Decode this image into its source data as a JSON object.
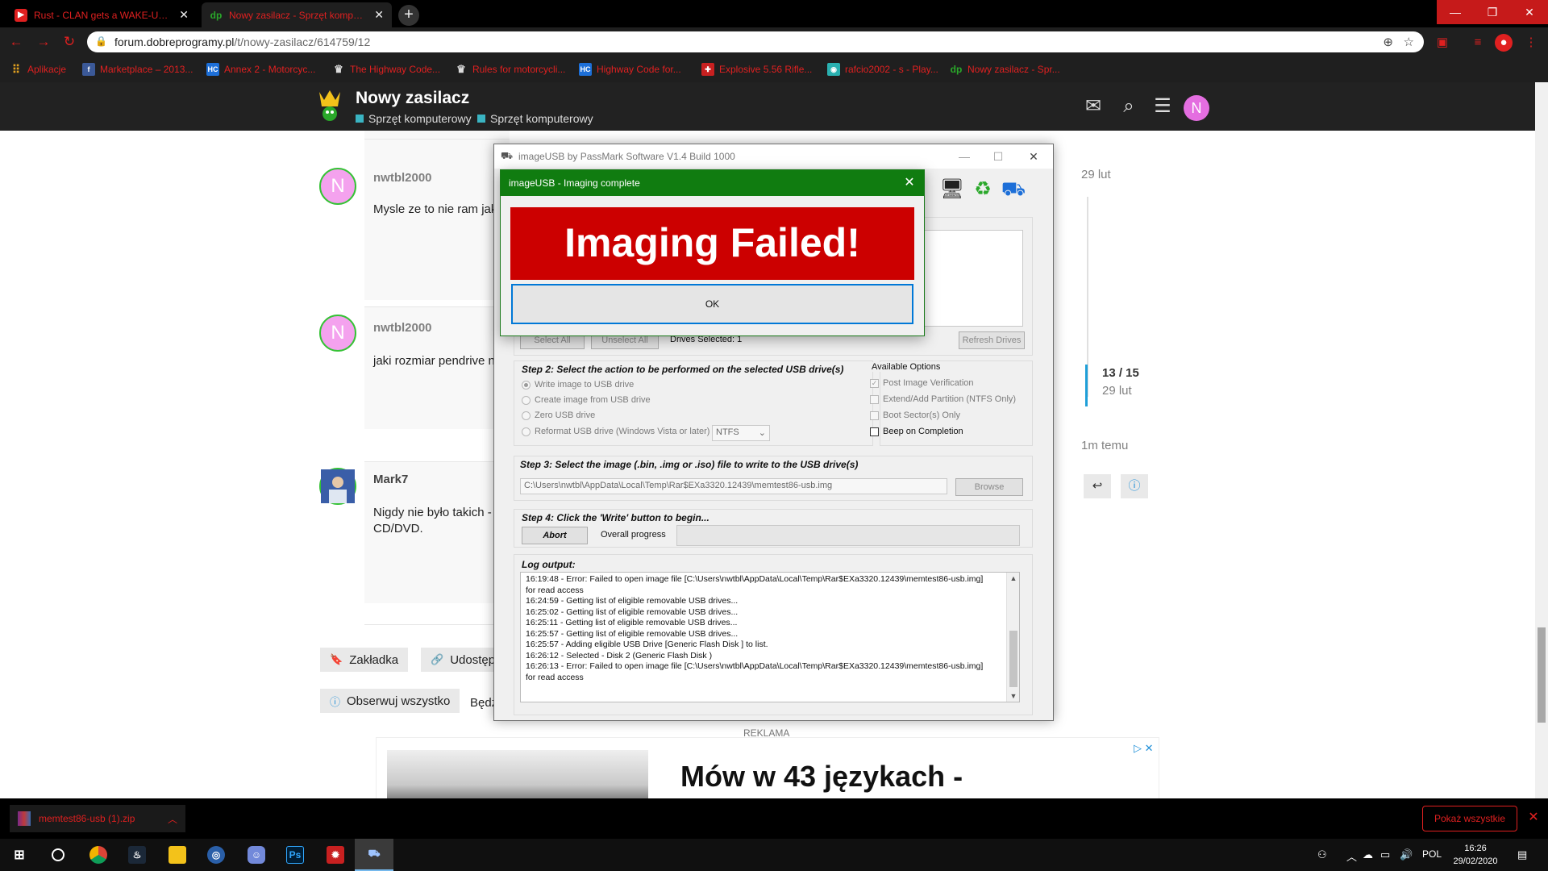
{
  "browser": {
    "tabs": [
      {
        "title": "Rust - CLAN gets a WAKE-UP CA",
        "favicon": "youtube-icon"
      },
      {
        "title": "Nowy zasilacz - Sprzęt komputer",
        "favicon": "dp-icon"
      }
    ],
    "new_tab": "+",
    "url_host": "forum.dobreprogramy.pl",
    "url_path": "/t/nowy-zasilacz/614759/12",
    "bookmarks": [
      {
        "label": "Aplikacje",
        "icon": "apps-grid-icon"
      },
      {
        "label": "Marketplace – 2013...",
        "icon": "facebook-icon"
      },
      {
        "label": "Annex 2 - Motorcyc...",
        "icon": "hc-icon"
      },
      {
        "label": "The Highway Code...",
        "icon": "crown-icon"
      },
      {
        "label": "Rules for motorcycli...",
        "icon": "crown-icon"
      },
      {
        "label": "Highway Code for...",
        "icon": "hc-icon"
      },
      {
        "label": "Explosive 5.56 Rifle...",
        "icon": "target-icon"
      },
      {
        "label": "rafcio2002 - s - Play...",
        "icon": "game-icon"
      },
      {
        "label": "Nowy zasilacz - Spr...",
        "icon": "dp-icon"
      }
    ]
  },
  "site": {
    "topic_title": "Nowy zasilacz",
    "categories": [
      "Sprzęt komputerowy",
      "Sprzęt komputerowy"
    ],
    "user_initial": "N"
  },
  "posts": [
    {
      "initial": "N",
      "username": "nwtbl2000",
      "text": "Mysle ze to nie ram jak"
    },
    {
      "initial": "N",
      "username": "nwtbl2000",
      "text": "jaki rozmiar pendrive n"
    },
    {
      "initial": "",
      "username": "Mark7",
      "text_line1": "Nigdy nie było takich -",
      "text_line2": "CD/DVD."
    }
  ],
  "actions": {
    "bookmark": "Zakładka",
    "share": "Udostęp",
    "watch": "Obserwuj wszystko",
    "partial": "Będz"
  },
  "timeline": {
    "top_date": "29 lut",
    "position": "13 / 15",
    "position_date": "29 lut",
    "bottom": "1m temu"
  },
  "ad": {
    "label": "REKLAMA",
    "headline": "Mów w 43 językach -"
  },
  "imageusb": {
    "window_title": "imageUSB by PassMark Software V1.4 Build 1000",
    "select_all": "Select All",
    "unselect_all": "Unselect All",
    "drives_selected": "Drives Selected: 1",
    "refresh_drives": "Refresh Drives",
    "step2_label": "Step 2: Select the action to be performed on the selected USB drive(s)",
    "actions": [
      {
        "label": "Write image to USB drive",
        "selected": true
      },
      {
        "label": "Create image from USB drive",
        "selected": false
      },
      {
        "label": "Zero USB drive",
        "selected": false
      },
      {
        "label": "Reformat USB drive (Windows Vista or later)",
        "selected": false
      }
    ],
    "fs_value": "NTFS",
    "options_label": "Available Options",
    "options": [
      {
        "label": "Post Image Verification",
        "checked": true,
        "enabled": false
      },
      {
        "label": "Extend/Add Partition (NTFS Only)",
        "checked": false,
        "enabled": false
      },
      {
        "label": "Boot Sector(s) Only",
        "checked": false,
        "enabled": false
      },
      {
        "label": "Beep on Completion",
        "checked": false,
        "enabled": true
      }
    ],
    "step3_label": "Step 3: Select the image (.bin, .img or .iso) file to write to the USB drive(s)",
    "image_path": "C:\\Users\\nwtbl\\AppData\\Local\\Temp\\Rar$EXa3320.12439\\memtest86-usb.img",
    "browse": "Browse",
    "step4_label": "Step 4: Click the 'Write' button to begin...",
    "abort": "Abort",
    "overall_progress": "Overall progress",
    "progress_value": 0,
    "log_label": "Log output:",
    "log": [
      "16:19:48 - Error: Failed to open image file [C:\\Users\\nwtbl\\AppData\\Local\\Temp\\Rar$EXa3320.12439\\memtest86-usb.img]",
      "for read access",
      "16:24:59 - Getting list of eligible removable USB drives...",
      "16:25:02 - Getting list of eligible removable USB drives...",
      "16:25:11 - Getting list of eligible removable USB drives...",
      "16:25:57 - Getting list of eligible removable USB drives...",
      "16:25:57 -    Adding eligible USB Drive [Generic  Flash Disk     ] to list.",
      "16:26:12 - Selected - Disk 2 (Generic  Flash Disk     )",
      "16:26:13 - Error: Failed to open image file [C:\\Users\\nwtbl\\AppData\\Local\\Temp\\Rar$EXa3320.12439\\memtest86-usb.img]",
      "for read access"
    ]
  },
  "dialog": {
    "title": "imageUSB - Imaging complete",
    "message": "Imaging Failed!",
    "ok": "OK",
    "banner_color": "#cc0000",
    "title_color": "#107c10"
  },
  "downloads": {
    "file": "memtest86-usb (1).zip",
    "show_all": "Pokaż wszystkie"
  },
  "taskbar": {
    "language": "POL",
    "time": "16:26",
    "date": "29/02/2020"
  }
}
